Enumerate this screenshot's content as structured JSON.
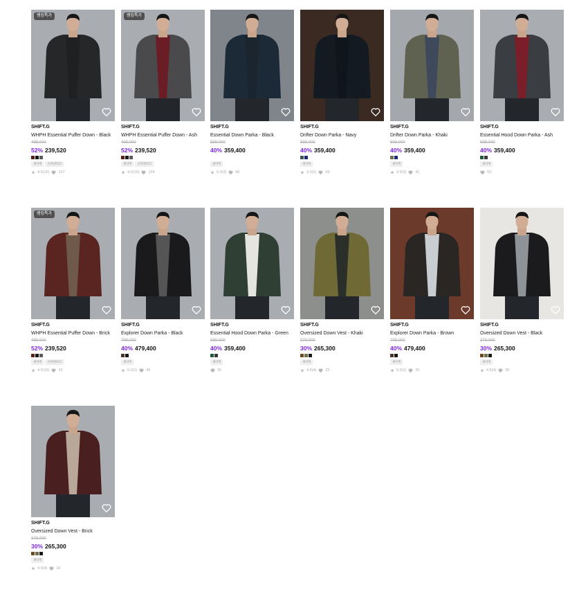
{
  "badge_label": "랭킹특가",
  "products": [
    {
      "brand": "SHIFT.G",
      "name": "WHPH Essential Puffer Down - Black",
      "orig": "499,000",
      "disc": "52%",
      "price": "239,520",
      "swatches": [
        "#5a2216",
        "#1a1a1a",
        "#5b5b5b"
      ],
      "tags": [
        "세이벡",
        "슈퍼랜위크"
      ],
      "rating": "4.5(16)",
      "likes": "137",
      "badge": true,
      "bg": "#a9adb2",
      "coat": "#262729",
      "inner": "#1f2022"
    },
    {
      "brand": "SHIFT.G",
      "name": "WHPH Essential Puffer Down - Ash",
      "orig": "499,000",
      "disc": "52%",
      "price": "239,520",
      "swatches": [
        "#5a2216",
        "#1a1a1a",
        "#5b5b5b"
      ],
      "tags": [
        "세이벡",
        "슈퍼랜위크"
      ],
      "rating": "4.5(16)",
      "likes": "124",
      "badge": true,
      "bg": "#a9adb2",
      "coat": "#4a4a4c",
      "inner": "#6b1d26"
    },
    {
      "brand": "SHIFT.G",
      "name": "Essential Down Parka - Black",
      "orig": "599,000",
      "disc": "40%",
      "price": "359,400",
      "swatches": [],
      "tags": [
        "세이벡"
      ],
      "rating": "5.0(3)",
      "likes": "86",
      "badge": false,
      "bg": "#7f858a",
      "coat": "#1c2a38",
      "inner": "#1b2530"
    },
    {
      "brand": "SHIFT.G",
      "name": "Drifter Down Parka - Navy",
      "orig": "599,000",
      "disc": "40%",
      "price": "359,400",
      "swatches": [
        "#3d5360",
        "#1a2a7a"
      ],
      "tags": [
        "세이벡"
      ],
      "rating": "3.0(2)",
      "likes": "69",
      "badge": false,
      "bg": "#3a2a22",
      "coat": "#141a22",
      "inner": "#10151c"
    },
    {
      "brand": "SHIFT.G",
      "name": "Drifter Down Parka - Khaki",
      "orig": "599,000",
      "disc": "40%",
      "price": "359,400",
      "swatches": [
        "#6e6f4a",
        "#1a2a7a"
      ],
      "tags": [
        "세이벡"
      ],
      "rating": "3.0(3)",
      "likes": "41",
      "badge": false,
      "bg": "#a4a8ac",
      "coat": "#5f6151",
      "inner": "#3e4a5c"
    },
    {
      "brand": "SHIFT.G",
      "name": "Essential Hood Down Parka - Ash",
      "orig": "599,000",
      "disc": "40%",
      "price": "359,400",
      "swatches": [
        "#1f5b3c",
        "#3a3a3a"
      ],
      "tags": [
        "세이벡"
      ],
      "rating": "",
      "likes": "53",
      "badge": false,
      "bg": "#a9adb2",
      "coat": "#3a3d42",
      "inner": "#7a1f2a"
    },
    {
      "brand": "SHIFT.G",
      "name": "WHPH Essential Puffer Down - Brick",
      "orig": "499,000",
      "disc": "52%",
      "price": "239,520",
      "swatches": [
        "#5a2216",
        "#1a1a1a",
        "#5b5b5b"
      ],
      "tags": [
        "세이벡",
        "슈퍼랜위크"
      ],
      "rating": "4.5(16)",
      "likes": "33",
      "badge": true,
      "bg": "#a9adb2",
      "coat": "#5a2421",
      "inner": "#6f5a4a"
    },
    {
      "brand": "SHIFT.G",
      "name": "Explorer Down Parka - Black",
      "orig": "799,000",
      "disc": "40%",
      "price": "479,400",
      "swatches": [
        "#4a3526",
        "#1a1a1a"
      ],
      "tags": [
        "세이벡"
      ],
      "rating": "5.0(1)",
      "likes": "45",
      "badge": false,
      "bg": "#a9adb2",
      "coat": "#1a1a1c",
      "inner": "#555"
    },
    {
      "brand": "SHIFT.G",
      "name": "Essential Hood Down Parka - Green",
      "orig": "599,000",
      "disc": "40%",
      "price": "359,400",
      "swatches": [
        "#1f5b3c",
        "#3a3a3a"
      ],
      "tags": [
        "세이벡"
      ],
      "rating": "",
      "likes": "26",
      "badge": false,
      "bg": "#a9adb2",
      "coat": "#2f3f33",
      "inner": "#e5e5e0"
    },
    {
      "brand": "SHIFT.G",
      "name": "Oversized Down Vest - Khaki",
      "orig": "379,000",
      "disc": "30%",
      "price": "265,300",
      "swatches": [
        "#6e4a20",
        "#6e6f4a",
        "#1a1a1a"
      ],
      "tags": [
        "세이벡"
      ],
      "rating": "4.5(4)",
      "likes": "22",
      "badge": false,
      "bg": "#8d8f8c",
      "coat": "#6f6a35",
      "inner": "#2a2f2a"
    },
    {
      "brand": "SHIFT.G",
      "name": "Explorer Down Parka - Brown",
      "orig": "799,000",
      "disc": "40%",
      "price": "479,400",
      "swatches": [
        "#4a3526",
        "#1a1a1a"
      ],
      "tags": [
        "세이벡"
      ],
      "rating": "5.0(1)",
      "likes": "26",
      "badge": false,
      "bg": "#6b3a2a",
      "coat": "#2a2624",
      "inner": "#c8cdd2"
    },
    {
      "brand": "SHIFT.G",
      "name": "Oversized Down Vest - Black",
      "orig": "379,000",
      "disc": "30%",
      "price": "265,300",
      "swatches": [
        "#6e4a20",
        "#6e6f4a",
        "#1a1a1a"
      ],
      "tags": [
        "세이벡"
      ],
      "rating": "4.5(4)",
      "likes": "30",
      "badge": false,
      "bg": "#e8e6e2",
      "coat": "#1b1b1d",
      "inner": "#8e9398"
    },
    {
      "brand": "SHIFT.G",
      "name": "Oversized Down Vest - Brick",
      "orig": "379,000",
      "disc": "30%",
      "price": "265,300",
      "swatches": [
        "#6e4a20",
        "#6e6f4a",
        "#1a1a1a"
      ],
      "tags": [
        "세이벡"
      ],
      "rating": "4.5(4)",
      "likes": "16",
      "badge": false,
      "bg": "#a9adb2",
      "coat": "#4a1f1f",
      "inner": "#b9a89a"
    }
  ]
}
